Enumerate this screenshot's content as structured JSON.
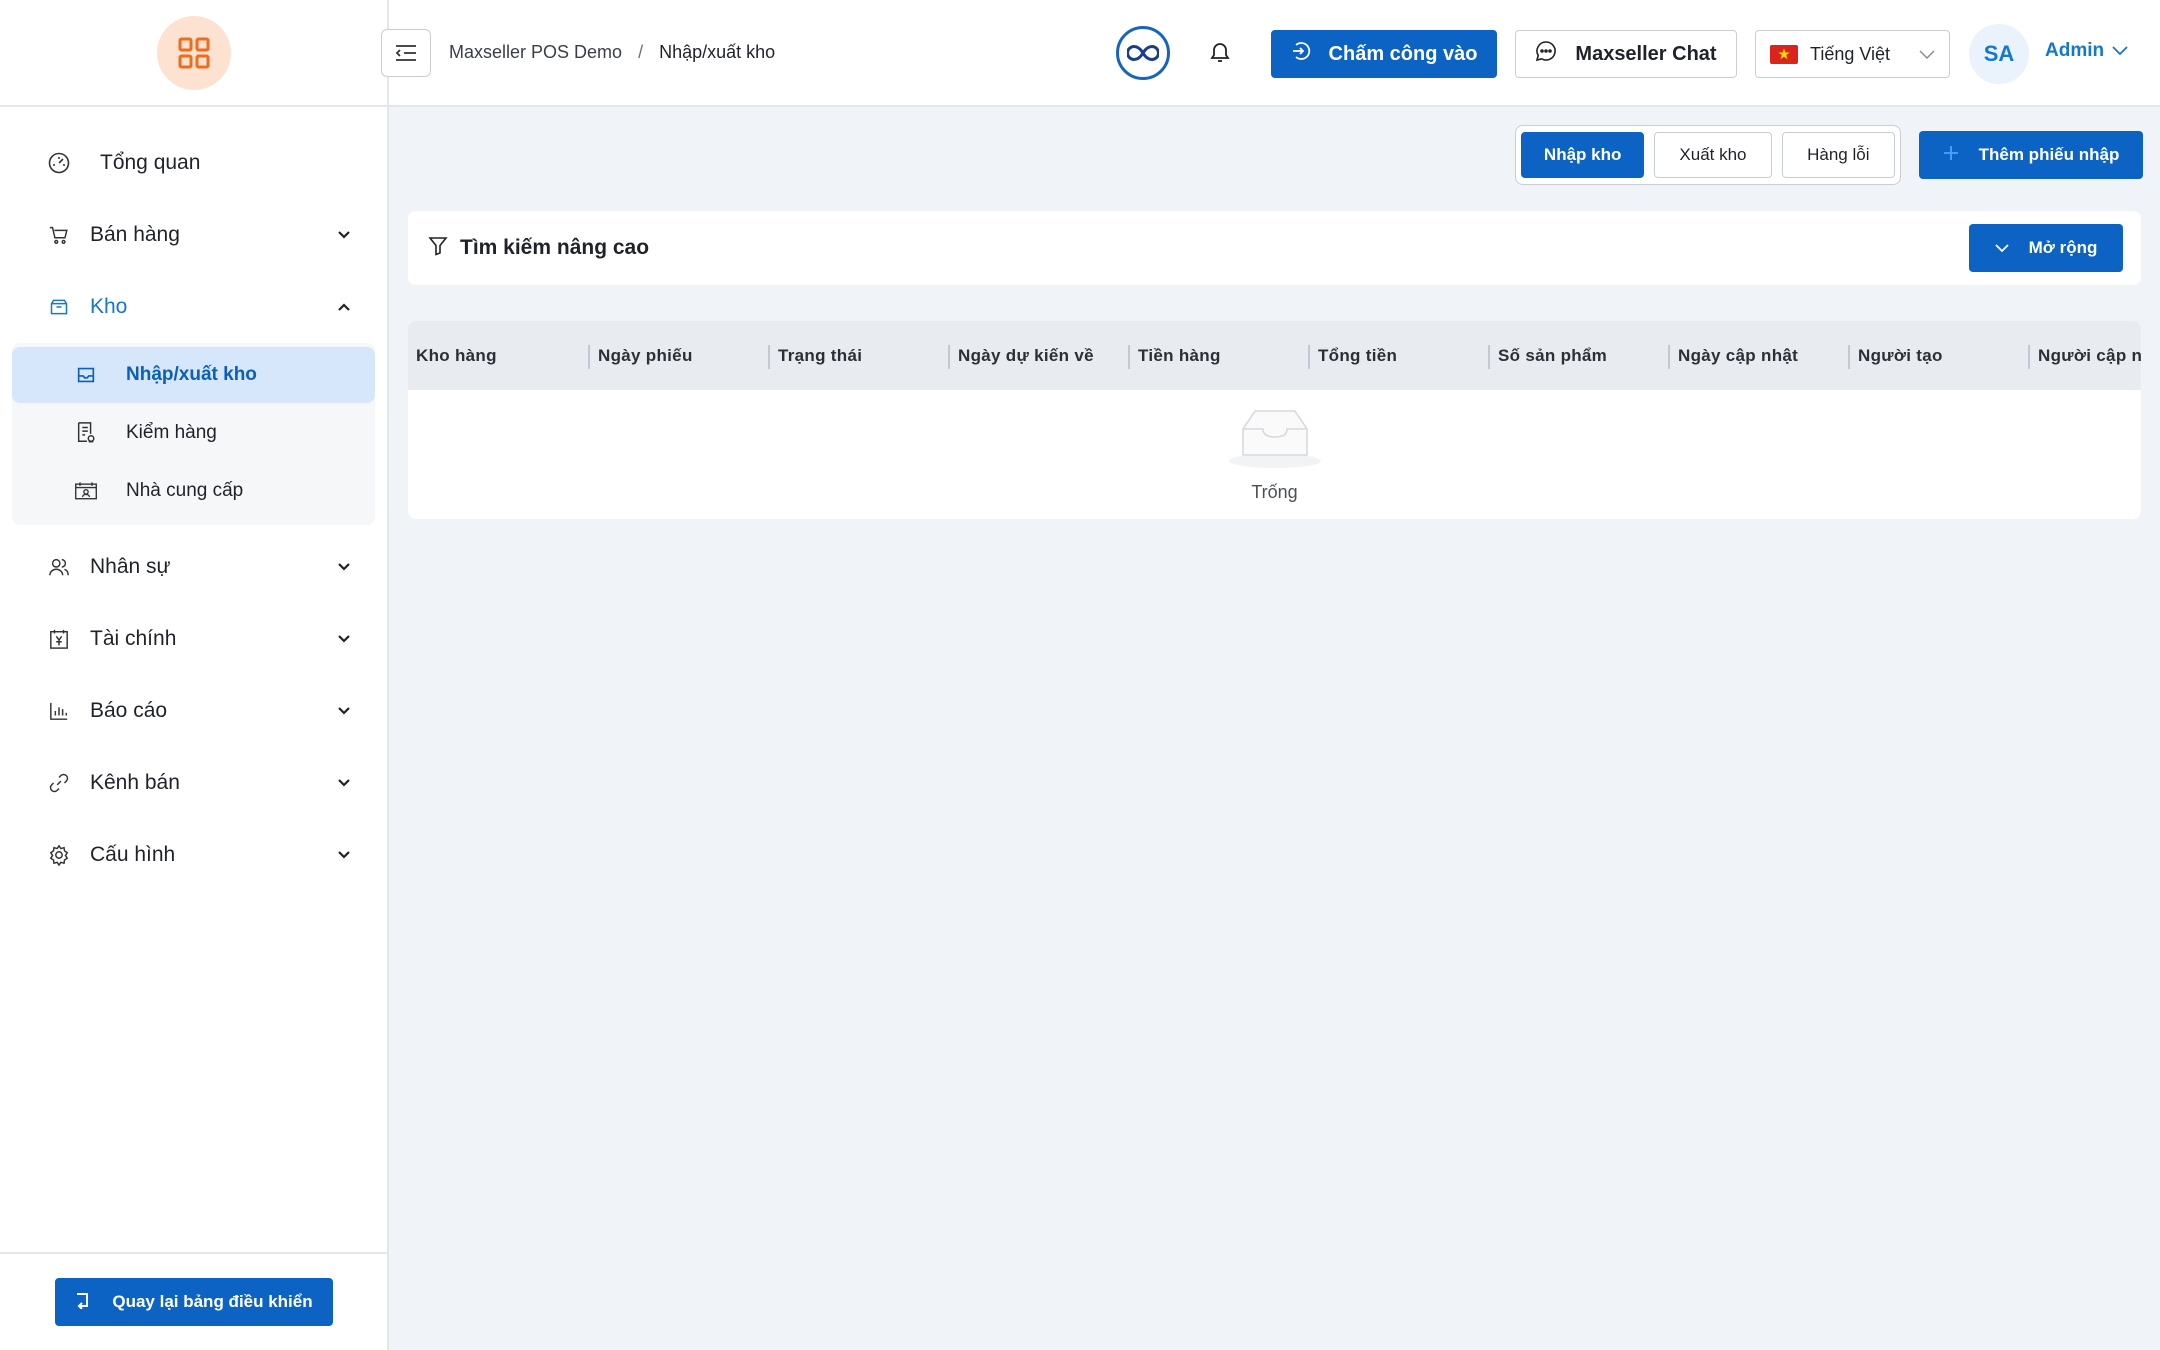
{
  "sidebar": {
    "items": [
      {
        "label": "Tổng quan"
      },
      {
        "label": "Bán hàng"
      },
      {
        "label": "Kho"
      },
      {
        "label": "Nhân sự"
      },
      {
        "label": "Tài chính"
      },
      {
        "label": "Báo cáo"
      },
      {
        "label": "Kênh bán"
      },
      {
        "label": "Cấu hình"
      }
    ],
    "kho_sub": [
      {
        "label": "Nhập/xuất kho"
      },
      {
        "label": "Kiểm hàng"
      },
      {
        "label": "Nhà cung cấp"
      }
    ],
    "back_label": "Quay lại bảng điều khiển"
  },
  "header": {
    "breadcrumb": [
      "Maxseller POS Demo",
      "Nhập/xuất kho"
    ],
    "breadcrumb_sep": "/",
    "checkin_label": "Chấm công vào",
    "chat_label": "Maxseller Chat",
    "language": "Tiếng Việt",
    "avatar_initials": "SA",
    "user": "Admin"
  },
  "main": {
    "segments": [
      "Nhập kho",
      "Xuất kho",
      "Hàng lỗi"
    ],
    "active_segment": "Nhập kho",
    "add_label": "Thêm phiếu nhập",
    "search_title": "Tìm kiếm nâng cao",
    "expand_label": "Mở rộng",
    "columns": [
      "Kho hàng",
      "Ngày phiếu",
      "Trạng thái",
      "Ngày dự kiến về",
      "Tiền hàng",
      "Tổng tiền",
      "Số sản phẩm",
      "Ngày cập nhật",
      "Người tạo",
      "Người cập nhật"
    ],
    "empty_label": "Trống"
  },
  "colors": {
    "primary": "#0c63c3",
    "accent": "#1677d2",
    "active_bg": "#d6e6fb",
    "logo_bg": "#fde2d2",
    "logo_fg": "#f26b1d",
    "page_bg": "#f0f3f8"
  },
  "icons": [
    "grid-logo-icon",
    "dashboard-icon",
    "cart-icon",
    "box-icon",
    "inbox-icon",
    "clipboard-icon",
    "supplier-icon",
    "users-icon",
    "finance-icon",
    "chart-icon",
    "link-icon",
    "gear-icon",
    "hamburger-icon",
    "infinity-icon",
    "bell-icon",
    "login-icon",
    "chat-icon",
    "flag-vn-icon",
    "chevron-down-icon",
    "plus-icon",
    "filter-icon",
    "back-icon",
    "empty-box-icon"
  ]
}
